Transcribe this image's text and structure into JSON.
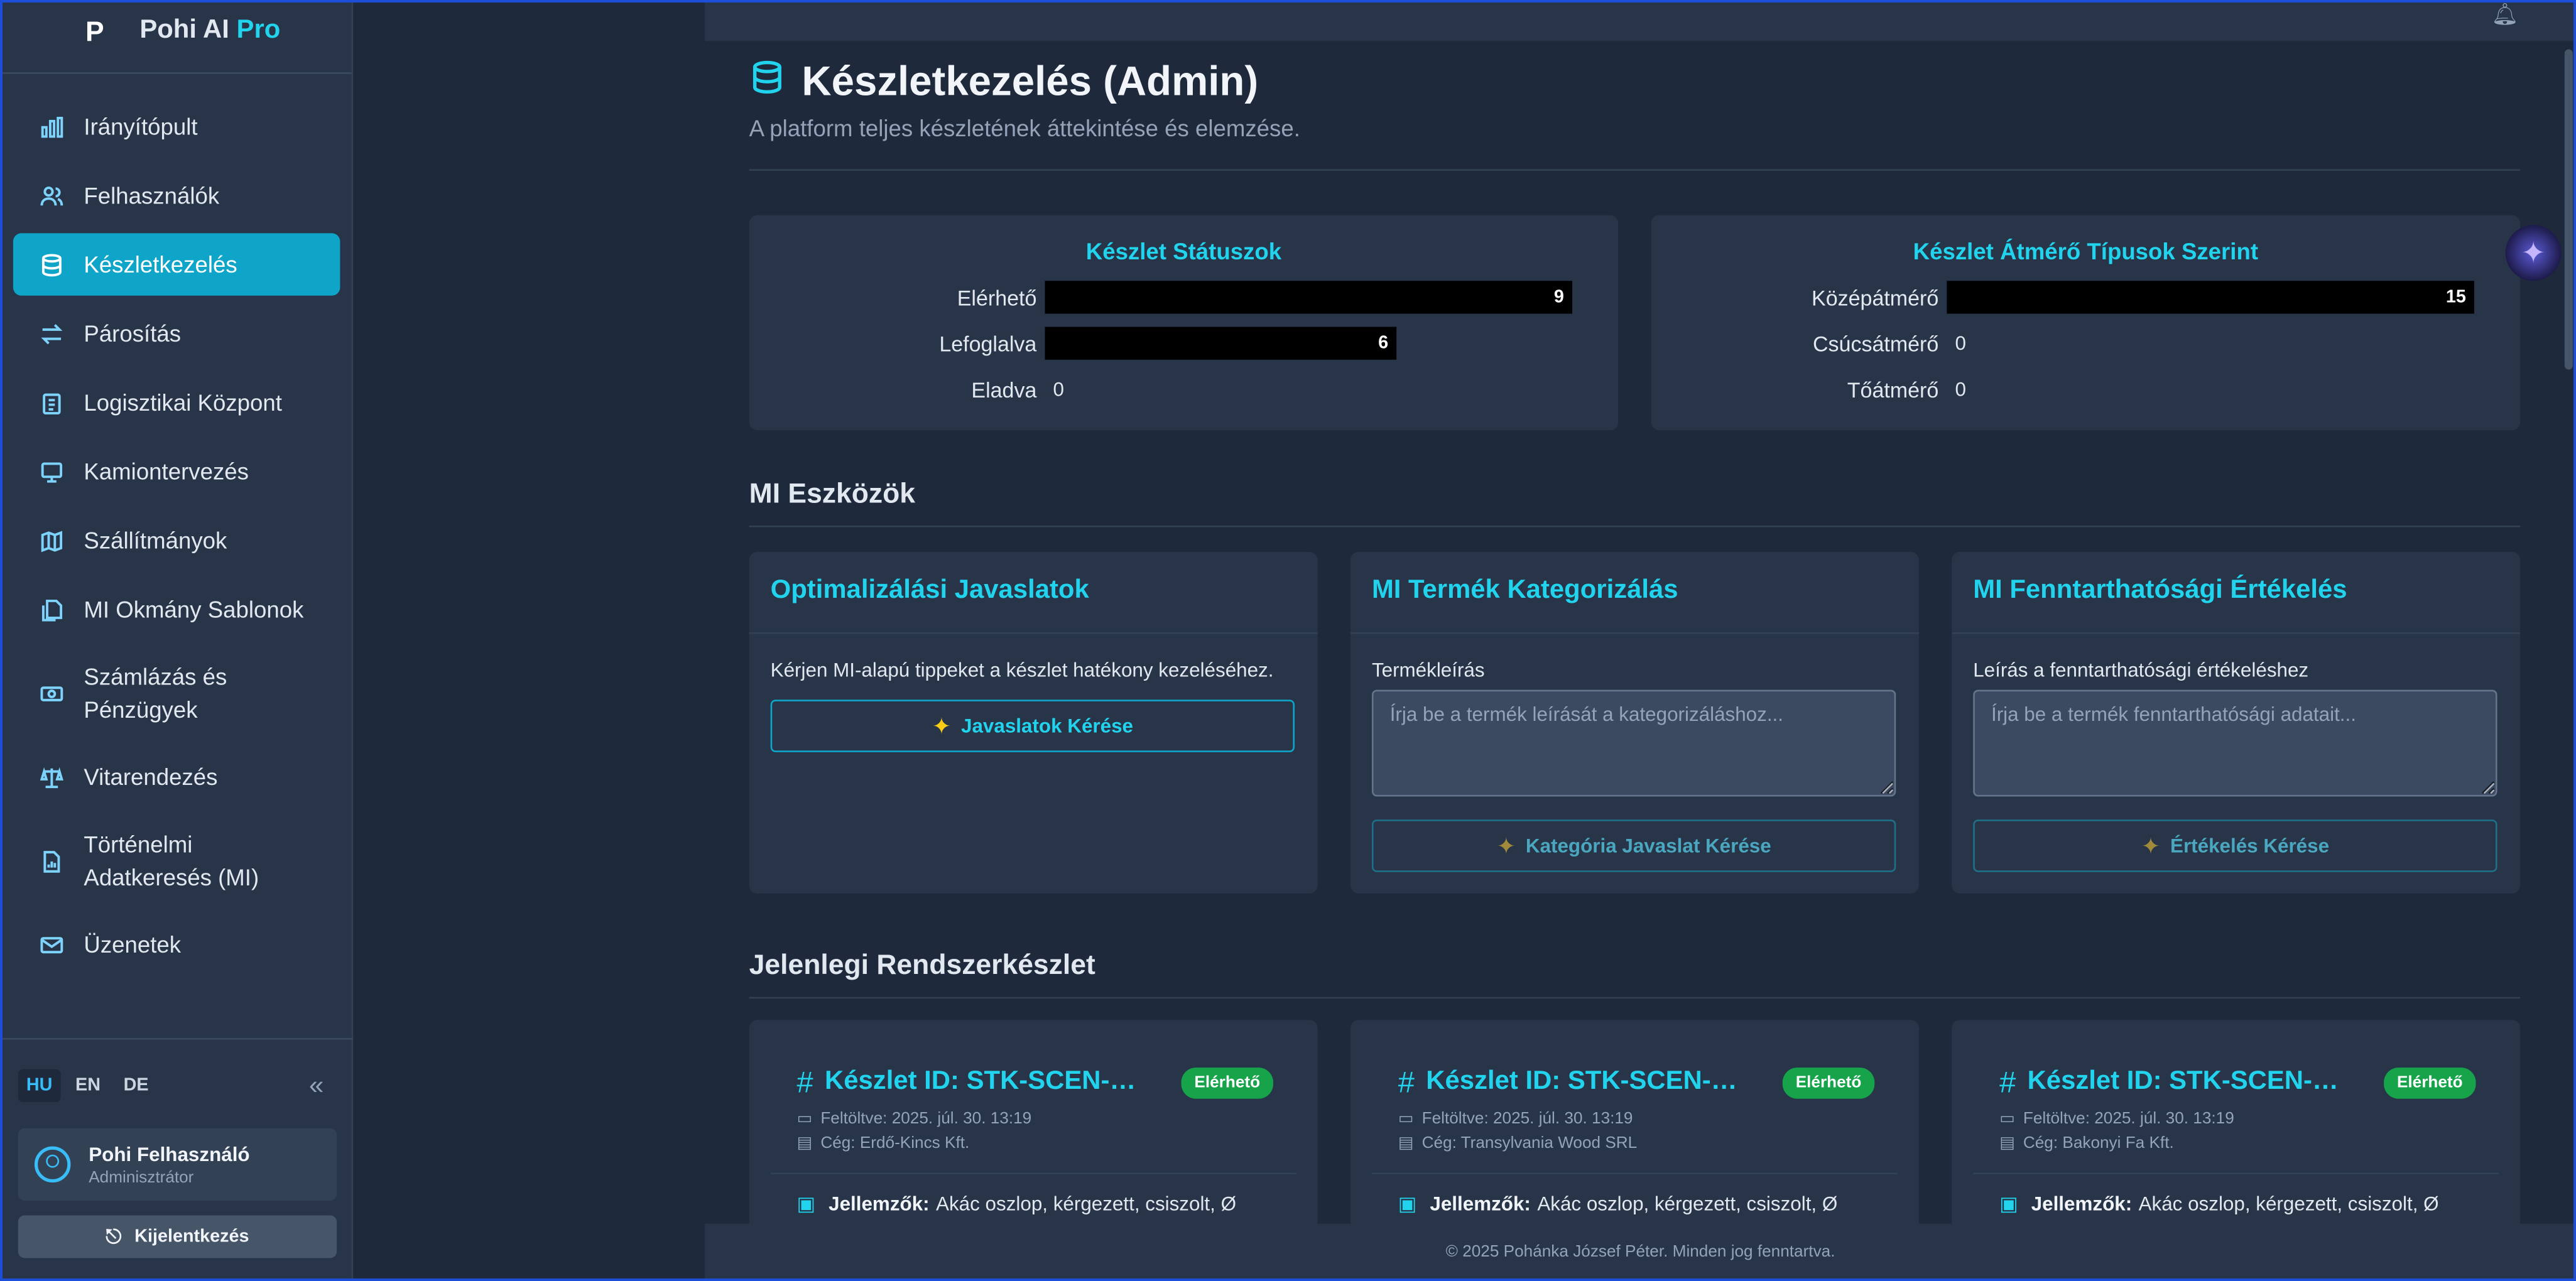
{
  "brand": {
    "name": "Pohi AI",
    "pro": "Pro",
    "logo": "P"
  },
  "nav": [
    {
      "label": "Irányítópult",
      "icon": "bar-chart-icon"
    },
    {
      "label": "Felhasználók",
      "icon": "users-icon"
    },
    {
      "label": "Készletkezelés",
      "icon": "database-icon",
      "active": true
    },
    {
      "label": "Párosítás",
      "icon": "arrows-icon"
    },
    {
      "label": "Logisztikai Központ",
      "icon": "clipboard-icon"
    },
    {
      "label": "Kamiontervezés",
      "icon": "monitor-icon"
    },
    {
      "label": "Szállítmányok",
      "icon": "map-icon"
    },
    {
      "label": "MI Okmány Sablonok",
      "icon": "files-icon"
    },
    {
      "label": "Számlázás és Pénzügyek",
      "icon": "banknote-icon"
    },
    {
      "label": "Vitarendezés",
      "icon": "scale-icon"
    },
    {
      "label": "Történelmi Adatkeresés (MI)",
      "icon": "file-chart-icon"
    },
    {
      "label": "Üzenetek",
      "icon": "mail-icon"
    }
  ],
  "langs": [
    "HU",
    "EN",
    "DE"
  ],
  "user": {
    "name": "Pohi Felhasználó",
    "role": "Adminisztrátor"
  },
  "logout": "Kijelentkezés",
  "page": {
    "title": "Készletkezelés (Admin)",
    "subtitle": "A platform teljes készletének áttekintése és elemzése."
  },
  "stats": {
    "status": {
      "title": "Készlet Státuszok",
      "rows": [
        {
          "label": "Elérhető",
          "value": 9
        },
        {
          "label": "Lefoglalva",
          "value": 6
        },
        {
          "label": "Eladva",
          "value": 0
        }
      ],
      "max": 9
    },
    "diameter": {
      "title": "Készlet Átmérő Típusok Szerint",
      "rows": [
        {
          "label": "Középátmérő",
          "value": 15
        },
        {
          "label": "Csúcsátmérő",
          "value": 0
        },
        {
          "label": "Tőátmérő",
          "value": 0
        }
      ],
      "max": 15
    }
  },
  "ai_tools": {
    "heading": "MI Eszközök",
    "opt": {
      "title": "Optimalizálási Javaslatok",
      "desc": "Kérjen MI-alapú tippeket a készlet hatékony kezeléséhez.",
      "button": "Javaslatok Kérése"
    },
    "cat": {
      "title": "MI Termék Kategorizálás",
      "field_label": "Termékleírás",
      "placeholder": "Írja be a termék leírását a kategorizáláshoz...",
      "button": "Kategória Javaslat Kérése"
    },
    "sus": {
      "title": "MI Fenntarthatósági Értékelés",
      "field_label": "Leírás a fenntarthatósági értékeléshez",
      "placeholder": "Írja be a termék fenntarthatósági adatait...",
      "button": "Értékelés Kérése"
    }
  },
  "inventory": {
    "heading": "Jelenlegi Rendszerkészlet",
    "items": [
      {
        "id": "Készlet ID: STK-SCEN-X...",
        "status": "Elérhető",
        "uploaded": "Feltöltve: 2025. júl. 30. 13:19",
        "company": "Cég: Erdő-Kincs Kft.",
        "features_label": "Jellemzők:",
        "features": "Akác oszlop, kérgezett, csiszolt, Ø"
      },
      {
        "id": "Készlet ID: STK-SCEN-Y...",
        "status": "Elérhető",
        "uploaded": "Feltöltve: 2025. júl. 30. 13:19",
        "company": "Cég: Transylvania Wood SRL",
        "features_label": "Jellemzők:",
        "features": "Akác oszlop, kérgezett, csiszolt, Ø"
      },
      {
        "id": "Készlet ID: STK-SCEN-Z...",
        "status": "Elérhető",
        "uploaded": "Feltöltve: 2025. júl. 30. 13:19",
        "company": "Cég: Bakonyi Fa Kft.",
        "features_label": "Jellemzők:",
        "features": "Akác oszlop, kérgezett, csiszolt, Ø"
      }
    ]
  },
  "footer": "© 2025 Pohánka József Péter. Minden jog fenntartva.",
  "colors": {
    "accent": "#22d3ee",
    "active_nav": "#0ea5c8",
    "badge": "#16a34a",
    "bg": "#1e293b",
    "panel": "#283548"
  }
}
